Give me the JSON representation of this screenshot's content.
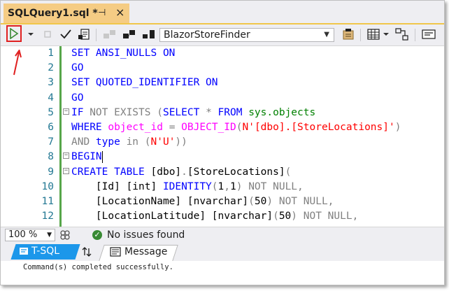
{
  "tab": {
    "title": "SQLQuery1.sql *",
    "pin_glyph": "⊣",
    "close_glyph": "×"
  },
  "toolbar": {
    "database": "BlazorStoreFinder"
  },
  "editor": {
    "lines": [
      {
        "n": "1",
        "fold": "",
        "tokens": [
          {
            "c": "kw",
            "t": "SET ANSI_NULLS ON"
          }
        ]
      },
      {
        "n": "2",
        "fold": "",
        "tokens": [
          {
            "c": "kw",
            "t": "GO"
          }
        ]
      },
      {
        "n": "3",
        "fold": "",
        "tokens": [
          {
            "c": "kw",
            "t": "SET QUOTED_IDENTIFIER ON"
          }
        ]
      },
      {
        "n": "4",
        "fold": "",
        "tokens": [
          {
            "c": "kw",
            "t": "GO"
          }
        ]
      },
      {
        "n": "5",
        "fold": "−",
        "tokens": [
          {
            "c": "kw",
            "t": "IF "
          },
          {
            "c": "gr",
            "t": "NOT EXISTS ("
          },
          {
            "c": "kw",
            "t": "SELECT "
          },
          {
            "c": "gr",
            "t": "* "
          },
          {
            "c": "kw",
            "t": "FROM "
          },
          {
            "c": "sy",
            "t": "sys.objects"
          }
        ]
      },
      {
        "n": "6",
        "fold": "",
        "tokens": [
          {
            "c": "kw",
            "t": "WHERE "
          },
          {
            "c": "fn",
            "t": "object_id "
          },
          {
            "c": "gr",
            "t": "= "
          },
          {
            "c": "fn",
            "t": "OBJECT_ID"
          },
          {
            "c": "gr",
            "t": "("
          },
          {
            "c": "st",
            "t": "N'[dbo].[StoreLocations]'"
          },
          {
            "c": "gr",
            "t": ")"
          }
        ]
      },
      {
        "n": "7",
        "fold": "",
        "tokens": [
          {
            "c": "gr",
            "t": "AND "
          },
          {
            "c": "kw",
            "t": "type "
          },
          {
            "c": "gr",
            "t": "in ("
          },
          {
            "c": "st",
            "t": "N'U'"
          },
          {
            "c": "gr",
            "t": "))"
          }
        ]
      },
      {
        "n": "8",
        "fold": "−",
        "tokens": [
          {
            "c": "kw",
            "t": "BEGIN"
          }
        ],
        "cursor": true
      },
      {
        "n": "9",
        "fold": "−",
        "tokens": [
          {
            "c": "kw",
            "t": "CREATE TABLE "
          },
          {
            "c": "tx",
            "t": "[dbo]"
          },
          {
            "c": "gr",
            "t": "."
          },
          {
            "c": "tx",
            "t": "[StoreLocations]"
          },
          {
            "c": "gr",
            "t": "("
          }
        ]
      },
      {
        "n": "10",
        "fold": "",
        "tokens": [
          {
            "c": "tx",
            "t": "    [Id] [int] "
          },
          {
            "c": "kw",
            "t": "IDENTITY"
          },
          {
            "c": "gr",
            "t": "("
          },
          {
            "c": "tx",
            "t": "1"
          },
          {
            "c": "gr",
            "t": ","
          },
          {
            "c": "tx",
            "t": "1"
          },
          {
            "c": "gr",
            "t": ") NOT NULL,"
          }
        ]
      },
      {
        "n": "11",
        "fold": "",
        "tokens": [
          {
            "c": "tx",
            "t": "    [LocationName] [nvarchar]"
          },
          {
            "c": "gr",
            "t": "("
          },
          {
            "c": "tx",
            "t": "50"
          },
          {
            "c": "gr",
            "t": ") NOT NULL,"
          }
        ]
      },
      {
        "n": "12",
        "fold": "",
        "tokens": [
          {
            "c": "tx",
            "t": "    [LocationLatitude] [nvarchar]"
          },
          {
            "c": "gr",
            "t": "("
          },
          {
            "c": "tx",
            "t": "50"
          },
          {
            "c": "gr",
            "t": ") NOT NULL,"
          }
        ]
      }
    ]
  },
  "status": {
    "zoom": "100 %",
    "message": "No issues found"
  },
  "results": {
    "tabs": {
      "tsql": "T-SQL",
      "message": "Message"
    },
    "output": "Command(s) completed successfully."
  },
  "colors": {
    "accent_tab": "#f5cc84",
    "tsql_tab": "#1c97ea",
    "annotation": "#e02020"
  }
}
